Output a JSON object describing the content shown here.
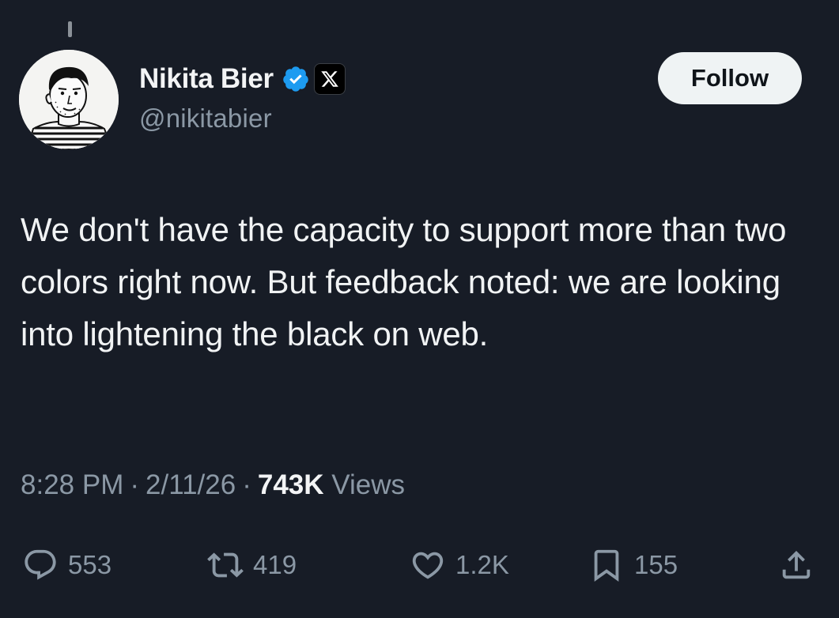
{
  "author": {
    "display_name": "Nikita Bier",
    "handle": "@nikitabier",
    "verified_icon": "verified-badge-icon",
    "affiliation_icon": "x-logo-icon"
  },
  "follow_label": "Follow",
  "tweet": {
    "text": "We don't have the capacity to support more than two colors right now. But feedback noted: we are looking into lightening the black on web.",
    "time": "8:28 PM",
    "date": "2/11/26",
    "separator": "·",
    "views_count": "743K",
    "views_label": "Views"
  },
  "actions": {
    "replies": "553",
    "reposts": "419",
    "likes": "1.2K",
    "bookmarks": "155"
  },
  "colors": {
    "background": "#171c26",
    "verified": "#1d9bf0",
    "secondary_text": "#8b98a5"
  }
}
